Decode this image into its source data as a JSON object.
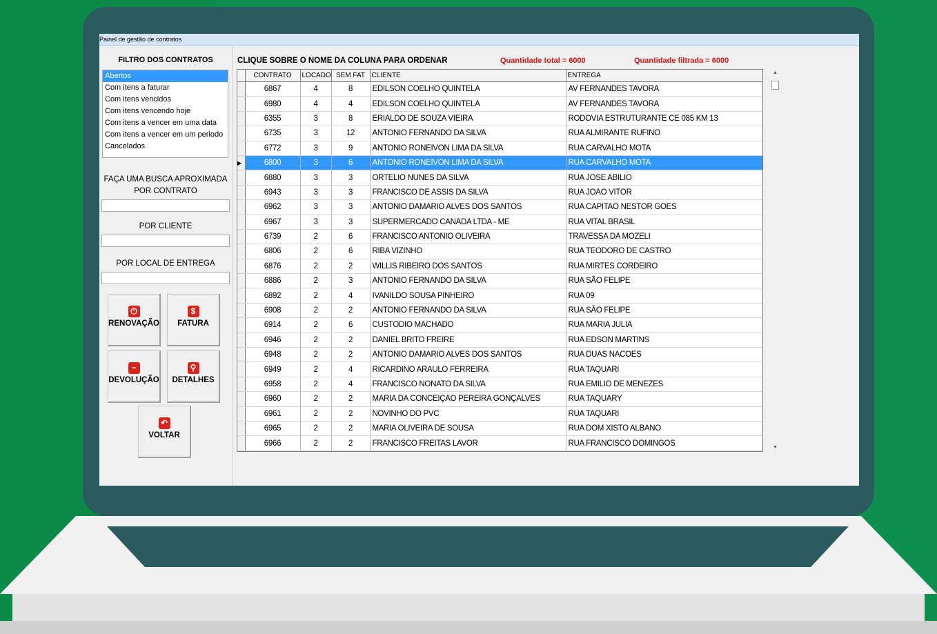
{
  "window": {
    "title": "Painel de gestão de contratos"
  },
  "filter": {
    "title": "FILTRO DOS CONTRATOS",
    "items": [
      "Abertos",
      "Com itens a faturar",
      "Com itens vencidos",
      "Com itens vencendo hoje",
      "Com itens a vencer em uma data",
      "Com itens a vencer em um periodo",
      "Cancelados"
    ],
    "selected_index": 0
  },
  "search": {
    "heading_line1": "FAÇA UMA BUSCA APROXIMADA",
    "contract_label": "POR CONTRATO",
    "contract_value": "",
    "client_label": "POR CLIENTE",
    "client_value": "",
    "delivery_label": "POR LOCAL DE ENTREGA",
    "delivery_value": ""
  },
  "buttons": {
    "renewal": {
      "label": "RENOVAÇÃO",
      "icon": "power-icon"
    },
    "invoice": {
      "label": "FATURA",
      "icon": "dollar-icon"
    },
    "return": {
      "label": "DEVOLUÇÃO",
      "icon": "minus-icon"
    },
    "details": {
      "label": "DETALHES",
      "icon": "search-icon"
    },
    "back": {
      "label": "VOLTAR",
      "icon": "undo-icon"
    }
  },
  "main": {
    "hint": "CLIQUE SOBRE O NOME DA COLUNA PARA ORDENAR",
    "qty_total": "Quantidade total = 6000",
    "qty_filtered": "Quantidade filtrada = 6000"
  },
  "colors": {
    "accent": "#3399ff",
    "alert": "#e01010",
    "button_icon": "#d9241c"
  },
  "grid": {
    "headers": [
      "CONTRATO",
      "LOCADO",
      "SEM FAT",
      "CLIENTE",
      "ENTREGA"
    ],
    "selected_row": 5,
    "rows": [
      [
        "6867",
        "4",
        "8",
        "EDILSON COELHO QUINTELA",
        "AV FERNANDES TAVORA"
      ],
      [
        "6980",
        "4",
        "4",
        "EDILSON COELHO QUINTELA",
        "AV FERNANDES TAVORA"
      ],
      [
        "6355",
        "3",
        "8",
        "ERIALDO DE SOUZA VIEIRA",
        "RODOVIA ESTRUTURANTE CE 085 KM 13"
      ],
      [
        "6735",
        "3",
        "12",
        "ANTONIO FERNANDO DA SILVA",
        "RUA ALMIRANTE RUFINO"
      ],
      [
        "6772",
        "3",
        "9",
        "ANTONIO RONEIVON LIMA DA SILVA",
        "RUA CARVALHO MOTA"
      ],
      [
        "6800",
        "3",
        "6",
        "ANTONIO RONEIVON LIMA DA SILVA",
        "RUA CARVALHO MOTA"
      ],
      [
        "6880",
        "3",
        "3",
        "ORTELIO NUNES DA SILVA",
        "RUA JOSE ABILIO"
      ],
      [
        "6943",
        "3",
        "3",
        "FRANCISCO DE ASSIS DA SILVA",
        "RUA JOAO VITOR"
      ],
      [
        "6962",
        "3",
        "3",
        "ANTONIO DAMARIO ALVES DOS SANTOS",
        "RUA CAPITAO NESTOR GOES"
      ],
      [
        "6967",
        "3",
        "3",
        "SUPERMERCADO CANADA LTDA - ME",
        "RUA VITAL BRASIL"
      ],
      [
        "6739",
        "2",
        "6",
        "FRANCISCO ANTONIO OLIVEIRA",
        "TRAVESSA DA MOZELI"
      ],
      [
        "6806",
        "2",
        "6",
        "RIBA VIZINHO",
        "RUA TEODORO DE CASTRO"
      ],
      [
        "6876",
        "2",
        "2",
        "WILLIS RIBEIRO DOS SANTOS",
        "RUA MIRTES CORDEIRO"
      ],
      [
        "6886",
        "2",
        "3",
        "ANTONIO FERNANDO DA SILVA",
        "RUA SÃO FELIPE"
      ],
      [
        "6892",
        "2",
        "4",
        "IVANILDO SOUSA PINHEIRO",
        "RUA 09"
      ],
      [
        "6908",
        "2",
        "2",
        "ANTONIO FERNANDO DA SILVA",
        "RUA SÃO FELIPE"
      ],
      [
        "6914",
        "2",
        "6",
        "CUSTODIO MACHADO",
        "RUA MARIA JULIA"
      ],
      [
        "6946",
        "2",
        "2",
        "DANIEL BRITO FREIRE",
        "RUA EDSON MARTINS"
      ],
      [
        "6948",
        "2",
        "2",
        "ANTONIO DAMARIO ALVES DOS SANTOS",
        "RUA DUAS NACOES"
      ],
      [
        "6949",
        "2",
        "4",
        "RICARDINO ARAULO FERREIRA",
        "RUA TAQUARI"
      ],
      [
        "6958",
        "2",
        "4",
        "FRANCISCO NONATO DA SILVA",
        "RUA EMILIO DE MENEZES"
      ],
      [
        "6960",
        "2",
        "2",
        "MARIA DA CONCEIÇAO PEREIRA GONÇALVES",
        "RUA TAQUARY"
      ],
      [
        "6961",
        "2",
        "2",
        "NOVINHO DO PVC",
        "RUA TAQUARI"
      ],
      [
        "6965",
        "2",
        "2",
        "MARIA OLIVEIRA DE SOUSA",
        "RUA DOM XISTO ALBANO"
      ],
      [
        "6966",
        "2",
        "2",
        "FRANCISCO FREITAS LAVOR",
        "RUA FRANCISCO DOMINGOS"
      ]
    ]
  }
}
